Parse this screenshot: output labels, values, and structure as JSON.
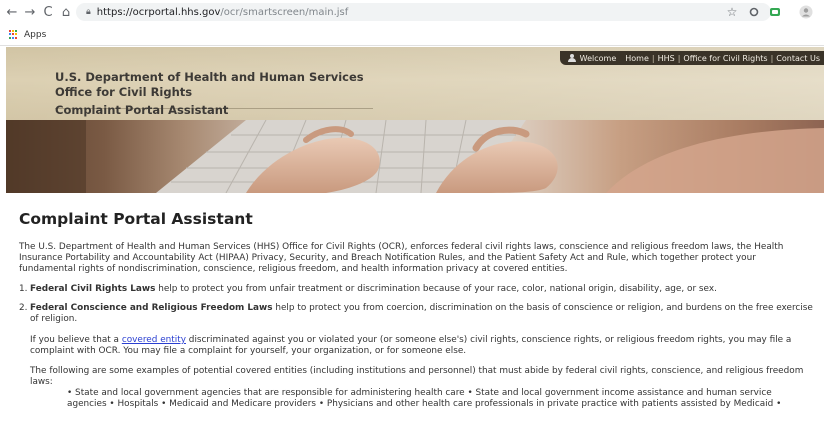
{
  "browser": {
    "nav": {
      "back": "←",
      "forward": "→",
      "reload": "C",
      "home": "⌂"
    },
    "url_host": "https://ocrportal.hhs.gov",
    "url_path": "/ocr/smartscreen/main.jsf",
    "bookmarks": {
      "apps_label": "Apps"
    }
  },
  "header": {
    "welcome": "Welcome",
    "links": [
      "Home",
      "HHS",
      "Office for Civil Rights",
      "Contact Us"
    ],
    "dept_line1": "U.S. Department of Health and Human Services",
    "dept_line2": "Office for Civil Rights",
    "portal_name": "Complaint Portal Assistant"
  },
  "main": {
    "title": "Complaint Portal Assistant",
    "intro": "The U.S. Department of Health and Human Services (HHS) Office for Civil Rights (OCR), enforces federal civil rights laws, conscience and religious freedom laws, the Health Insurance Portability and Accountability Act (HIPAA) Privacy, Security, and Breach Notification Rules, and the Patient Safety Act and Rule, which together protect your fundamental rights of nondiscrimination, conscience, religious freedom, and health information privacy at covered entities.",
    "laws": [
      {
        "num": "1.",
        "bold": "Federal Civil Rights Laws",
        "text": " help to protect you from unfair treatment or discrimination because of your race, color, national origin, disability, age, or sex."
      },
      {
        "num": "2.",
        "bold": "Federal Conscience and Religious Freedom Laws",
        "text": " help to protect you from coercion, discrimination on the basis of conscience or religion, and burdens on the free exercise of religion."
      }
    ],
    "complaint_pre": "If you believe that a ",
    "covered_entity_link": "covered entity",
    "complaint_post": " discriminated against you or violated your (or someone else's) civil rights, conscience rights, or religious freedom rights, you may file a complaint with OCR. You may file a complaint for yourself, your organization, or for someone else.",
    "examples_intro": "The following are some examples of potential covered entities (including institutions and personnel) that must abide by federal civil rights, conscience, and religious freedom laws:",
    "examples_bullets": "• State and local government agencies that are responsible for administering health care • State and local government income assistance and human service agencies • Hospitals • Medicaid and Medicare providers • Physicians and other health care professionals in private practice with patients assisted by Medicaid •"
  },
  "colors": {
    "link": "#2a3fd1",
    "header_band": "#d5c7a6",
    "nav_bar": "#3a3328",
    "apps_grid": [
      "#ea4335",
      "#fbbc05",
      "#34a853",
      "#4285f4"
    ]
  },
  "icons": {
    "lock": "lock-icon",
    "star": "star-icon",
    "user": "user-icon",
    "apps": "apps-grid-icon"
  }
}
